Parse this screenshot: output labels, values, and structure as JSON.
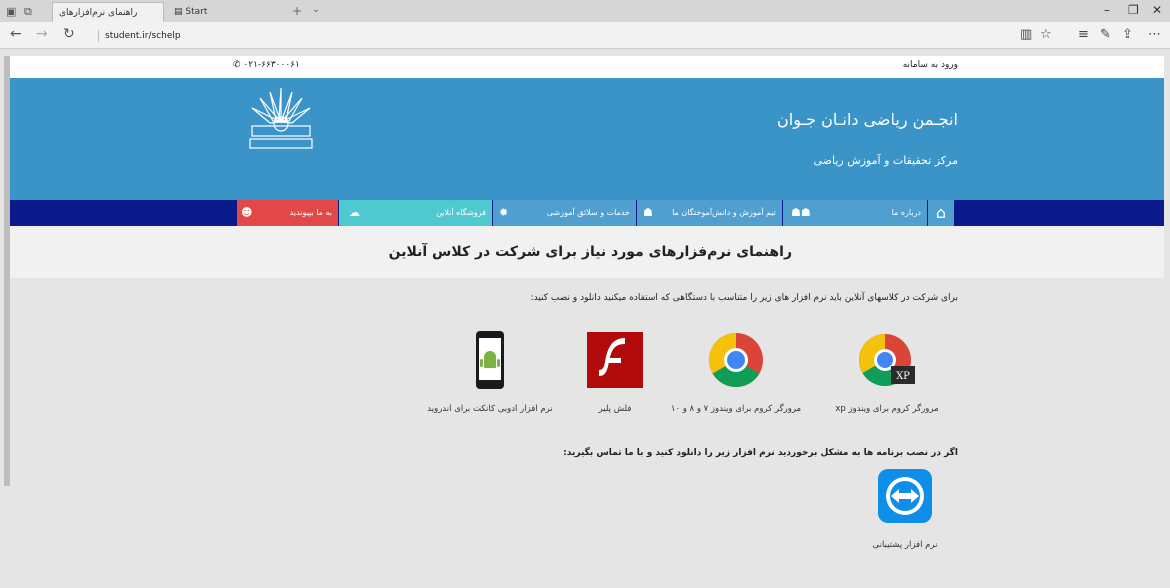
{
  "browser": {
    "tabs": [
      {
        "label": "راهنمای نرم‌افزارهای مورد..."
      },
      {
        "label": "Start"
      }
    ],
    "address": "student.ir/schelp"
  },
  "page": {
    "top_bar": {
      "phone": "۰۲۱-۶۶۳۰۰۰۶۱",
      "login": "ورود به سامانه"
    },
    "header": {
      "title": "انجـمن ریاضی دانـان جـوان",
      "subtitle": "مرکز تحقیقات و آموزش ریاضی"
    },
    "nav": {
      "items": [
        {
          "label": "درباره ما"
        },
        {
          "label": "تیم آموزش و دانش‌آموختگان ما"
        },
        {
          "label": "خدمات و سلائق آموزشی"
        },
        {
          "label": "فروشگاه آنلاین"
        },
        {
          "label": "به ما بپیوندید"
        }
      ]
    },
    "heading": "راهنمای نرم‌فزارهای مورد نیاز برای شرکت در کلاس آنلاین",
    "intro": "برای شرکت در کلاسهای آنلاین باید نرم افزار های زیر را متناسب با دستگاهی که استفاده میکنید دانلود و نصب کنید:",
    "software": [
      {
        "label": "مرورگر کروم برای ویندوز xp",
        "icon": "chrome-xp-icon"
      },
      {
        "label": "مرورگر کروم برای ویندوز ۷ و ۸ و ۱۰",
        "icon": "chrome-icon"
      },
      {
        "label": "فلش پلیر",
        "icon": "flash-icon"
      },
      {
        "label": "نرم افزار ادوبی کانکت برای اندروید",
        "icon": "android-phone-icon"
      }
    ],
    "problem_text": "اگر در نصب برنامه ها به مشکل برخوردید نرم افزار زیر را دانلود کنید و با ما تماس بگیرید:",
    "support": {
      "label": "نرم افزار پشتیبانی",
      "icon": "teamviewer-icon"
    }
  }
}
